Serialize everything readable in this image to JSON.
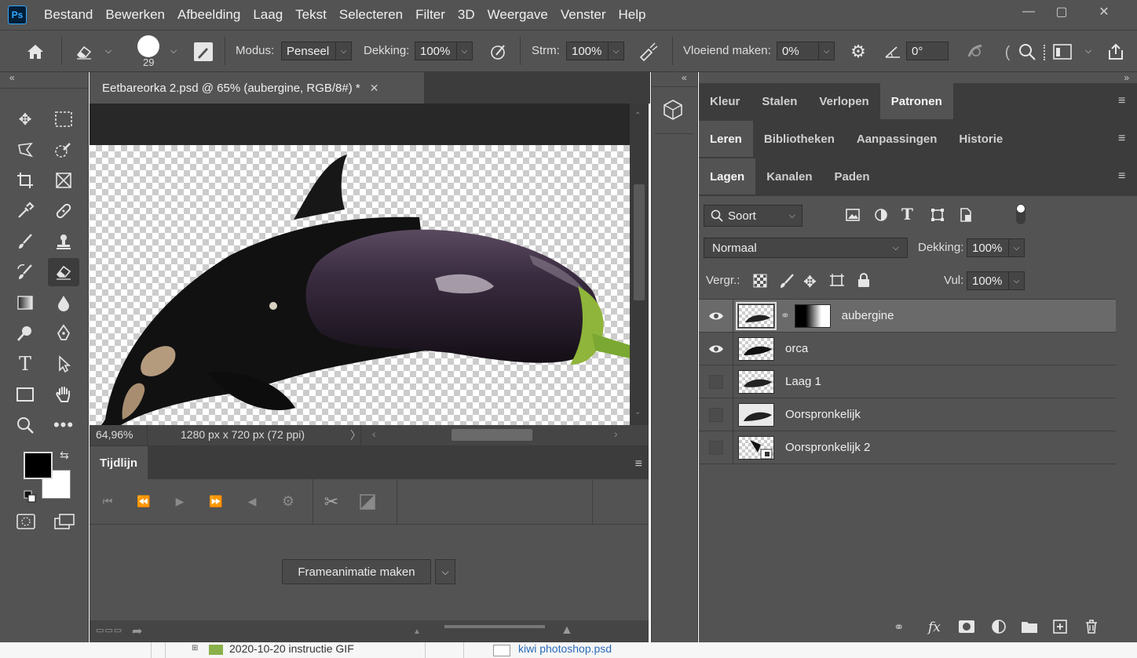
{
  "app": {
    "logo": "Ps",
    "window_controls": [
      "minimize-icon",
      "maximize-icon",
      "close-icon"
    ]
  },
  "menu": [
    "Bestand",
    "Bewerken",
    "Afbeelding",
    "Laag",
    "Tekst",
    "Selecteren",
    "Filter",
    "3D",
    "Weergave",
    "Venster",
    "Help"
  ],
  "options": {
    "brush_size": "29",
    "modus_label": "Modus:",
    "modus_value": "Penseel",
    "dekking_label": "Dekking:",
    "dekking_value": "100%",
    "strm_label": "Strm:",
    "strm_value": "100%",
    "vloeiend_label": "Vloeiend maken:",
    "vloeiend_value": "0%",
    "angle_value": "0°"
  },
  "document": {
    "tab_title": "Eetbareorka 2.psd @ 65% (aubergine, RGB/8#) *",
    "zoom": "64,96%",
    "dimensions": "1280 px x 720 px (72 ppi)"
  },
  "timeline": {
    "tab": "Tijdlijn",
    "create_button": "Frameanimatie maken"
  },
  "panels": {
    "top_tabs": [
      "Kleur",
      "Stalen",
      "Verlopen",
      "Patronen"
    ],
    "mid_tabs": [
      "Leren",
      "Bibliotheken",
      "Aanpassingen",
      "Historie"
    ],
    "layer_tabs": [
      "Lagen",
      "Kanalen",
      "Paden"
    ],
    "filter_label": "Soort",
    "blend_mode": "Normaal",
    "dekking_label": "Dekking:",
    "dekking_value": "100%",
    "vergr_label": "Vergr.:",
    "vul_label": "Vul:",
    "vul_value": "100%"
  },
  "layers": [
    {
      "name": "aubergine",
      "visible": true,
      "selected": true
    },
    {
      "name": "orca",
      "visible": true,
      "selected": false
    },
    {
      "name": "Laag 1",
      "visible": false,
      "selected": false
    },
    {
      "name": "Oorspronkelijk",
      "visible": false,
      "selected": false
    },
    {
      "name": "Oorspronkelijk 2",
      "visible": false,
      "selected": false
    }
  ],
  "background": {
    "folder_item": "2020-10-20 instructie GIF",
    "file_item": "kiwi photoshop.psd"
  }
}
